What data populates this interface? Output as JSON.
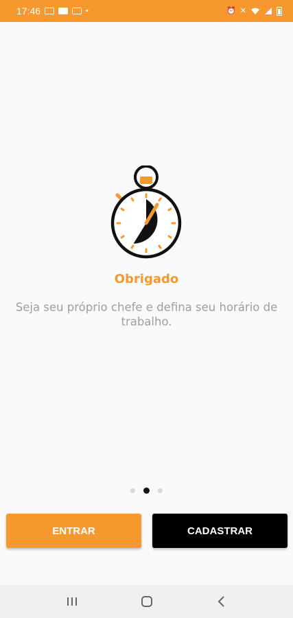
{
  "status_bar": {
    "time": "17:46",
    "background": "#f7982f"
  },
  "onboarding": {
    "icon": "stopwatch-icon",
    "title": "Obrigado",
    "subtitle": "Seja seu próprio chefe e defina seu horário de trabalho.",
    "page_indicator": {
      "total": 3,
      "current": 2
    }
  },
  "actions": {
    "login_label": "ENTRAR",
    "signup_label": "CADASTRAR"
  },
  "navigation": {
    "recent_apps": "recent-apps-icon",
    "home": "home-icon",
    "back": "back-icon"
  },
  "colors": {
    "accent": "#f7982f",
    "dark": "#000000",
    "muted_text": "#9e9e9e"
  }
}
